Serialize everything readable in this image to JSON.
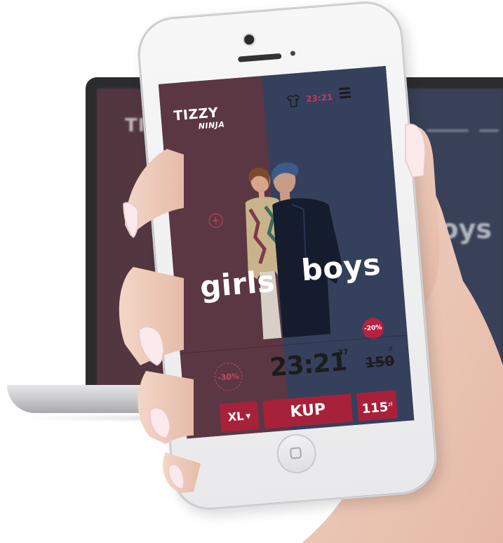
{
  "laptop": {
    "logo_text": "TIZZY",
    "hero_word": "oys"
  },
  "app": {
    "logo": "TIZZY",
    "logo_sub": "NINJA",
    "header_timer": "23:21",
    "plus_label": "+",
    "girls_label": "girls",
    "boys_label": "boys",
    "discount_right": "-20%",
    "discount_left": "-30%",
    "timer_main": "23:21",
    "timer_seconds": "37",
    "old_price": "150",
    "currency": "zł",
    "size_label": "XL",
    "buy_label": "KUP",
    "price": "115",
    "price_currency": "zł"
  },
  "colors": {
    "girls_bg": "#5b3744",
    "boys_bg": "#35405c",
    "accent": "#a8213b",
    "timer_accent": "#c13b57"
  },
  "icons": {
    "shirt": "shirt-icon",
    "menu": "hamburger-menu-icon",
    "home": "home-button-icon"
  }
}
